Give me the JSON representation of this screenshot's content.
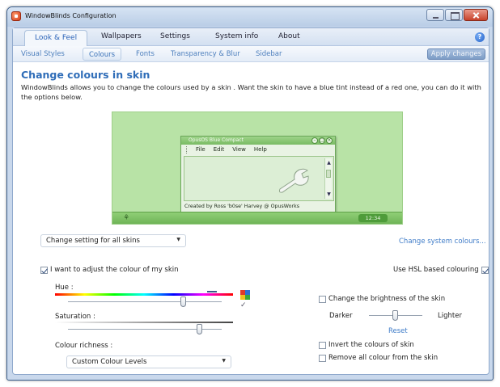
{
  "window": {
    "title": "WindowBlinds Configuration"
  },
  "tabs": [
    {
      "label": "Look & Feel"
    },
    {
      "label": "Wallpapers"
    },
    {
      "label": "Settings"
    },
    {
      "label": "System info"
    },
    {
      "label": "About"
    }
  ],
  "subtabs": [
    {
      "label": "Visual Styles"
    },
    {
      "label": "Colours"
    },
    {
      "label": "Fonts"
    },
    {
      "label": "Transparency & Blur"
    },
    {
      "label": "Sidebar"
    }
  ],
  "apply_label": "Apply changes",
  "page": {
    "heading": "Change colours in skin",
    "description": "WindowBlinds allows you to change the colours used by a skin .  Want the skin to have a blue tint instead of a red one, you can do it with the options below."
  },
  "preview": {
    "window_title": "OpusOS Blue Compact",
    "menu": [
      "File",
      "Edit",
      "View",
      "Help"
    ],
    "status": "Created by Ross 'b0se' Harvey @ OpusWorks",
    "clock": "12:34"
  },
  "apply_scope": {
    "selected": "Change setting for all skins"
  },
  "system_colours_link": "Change system colours...",
  "adjust_checkbox": {
    "label": "I want to adjust the colour of my skin",
    "checked": true
  },
  "hsl_checkbox": {
    "label": "Use HSL based colouring",
    "checked": true
  },
  "hue": {
    "label": "Hue :",
    "value": 0.75
  },
  "saturation": {
    "label": "Saturation :",
    "value": 0.86
  },
  "richness": {
    "label": "Colour richness :",
    "selected": "Custom Colour Levels"
  },
  "brightness": {
    "checkbox_label": "Change the brightness of the skin",
    "checked": false,
    "darker_label": "Darker",
    "lighter_label": "Lighter",
    "reset_label": "Reset",
    "value": 0.5
  },
  "invert_checkbox": {
    "label": "Invert the colours of skin",
    "checked": false
  },
  "remove_checkbox": {
    "label": "Remove all colour from the skin",
    "checked": false
  },
  "colors": {
    "accent": "#2f6db8",
    "link": "#3f7cc8",
    "preview_green": "#b8e3a6"
  }
}
